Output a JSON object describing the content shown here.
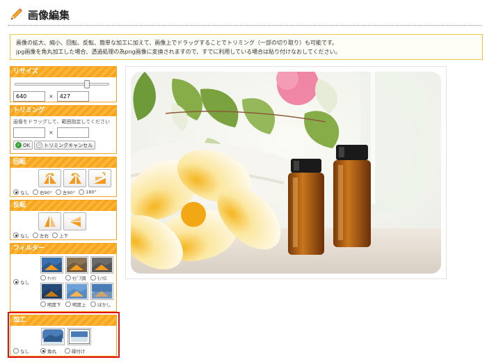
{
  "header": {
    "title": "画像編集",
    "icon": "pencil-icon"
  },
  "notice": {
    "line1": "画像の拡大、縮小、回転、反転、簡単な加工に加えて、画像上でドラッグすることでトリミング（一部の切り取り）も可能です。",
    "line2": "jpg画像を角丸加工した場合、透過処理の為png画像に変換されますので、すでに利用している場合は貼り付けなおしてください。"
  },
  "resize": {
    "title": "リサイズ",
    "width": "640",
    "height": "427",
    "separator": "×",
    "slider_level": 0.78
  },
  "trim": {
    "title": "トリミング",
    "hint": "画像をドラッグして、範囲指定してください",
    "separator": "×",
    "width": "",
    "height": "",
    "ok_label": "OK",
    "cancel_label": "トリミングキャンセル"
  },
  "rotate": {
    "title": "回転",
    "options": [
      "なし",
      "右90°",
      "左90°",
      "180°"
    ],
    "selected": 0
  },
  "flip": {
    "title": "反転",
    "options": [
      "なし",
      "左右",
      "上下"
    ],
    "selected": 0
  },
  "filter": {
    "title": "フィルター",
    "none_label": "なし",
    "options": [
      "ｸｯｷﾘ",
      "ｾﾋﾟｱ調",
      "ﾓﾉｸﾛ",
      "明度下",
      "明度上",
      "ぼかし"
    ],
    "selected": "none"
  },
  "process": {
    "title": "加工",
    "options": [
      "なし",
      "角丸",
      "縁付け"
    ],
    "selected": 1
  },
  "colors": {
    "accent": "#f7a51c",
    "highlight": "#e01010",
    "notice_border": "#f0c44a"
  }
}
